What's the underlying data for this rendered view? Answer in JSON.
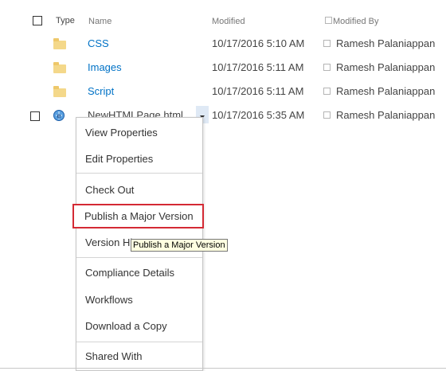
{
  "header": {
    "type": "Type",
    "name": "Name",
    "modified": "Modified",
    "modified_by": "Modified By"
  },
  "rows": [
    {
      "icon": "folder-icon",
      "name": "CSS",
      "modified": "10/17/2016 5:10 AM",
      "modified_by": "Ramesh Palaniappan"
    },
    {
      "icon": "folder-icon",
      "name": "Images",
      "modified": "10/17/2016 5:11 AM",
      "modified_by": "Ramesh Palaniappan"
    },
    {
      "icon": "folder-icon",
      "name": "Script",
      "modified": "10/17/2016 5:11 AM",
      "modified_by": "Ramesh Palaniappan"
    },
    {
      "icon": "html-file-icon",
      "name": "NewHTMLPage.html",
      "modified": "10/17/2016 5:35 AM",
      "modified_by": "Ramesh Palaniappan"
    }
  ],
  "context_menu": {
    "items": [
      "View Properties",
      "Edit Properties",
      "Check Out",
      "Publish a Major Version",
      "Version History",
      "Compliance Details",
      "Workflows",
      "Download a Copy",
      "Shared With"
    ],
    "version_history_visible": "Version Hi",
    "highlighted": "Publish a Major Version"
  },
  "tooltip": "Publish a Major Version",
  "colors": {
    "link": "#0072c6",
    "highlight_border": "#d42a34",
    "tooltip_bg": "#ffffe1"
  }
}
